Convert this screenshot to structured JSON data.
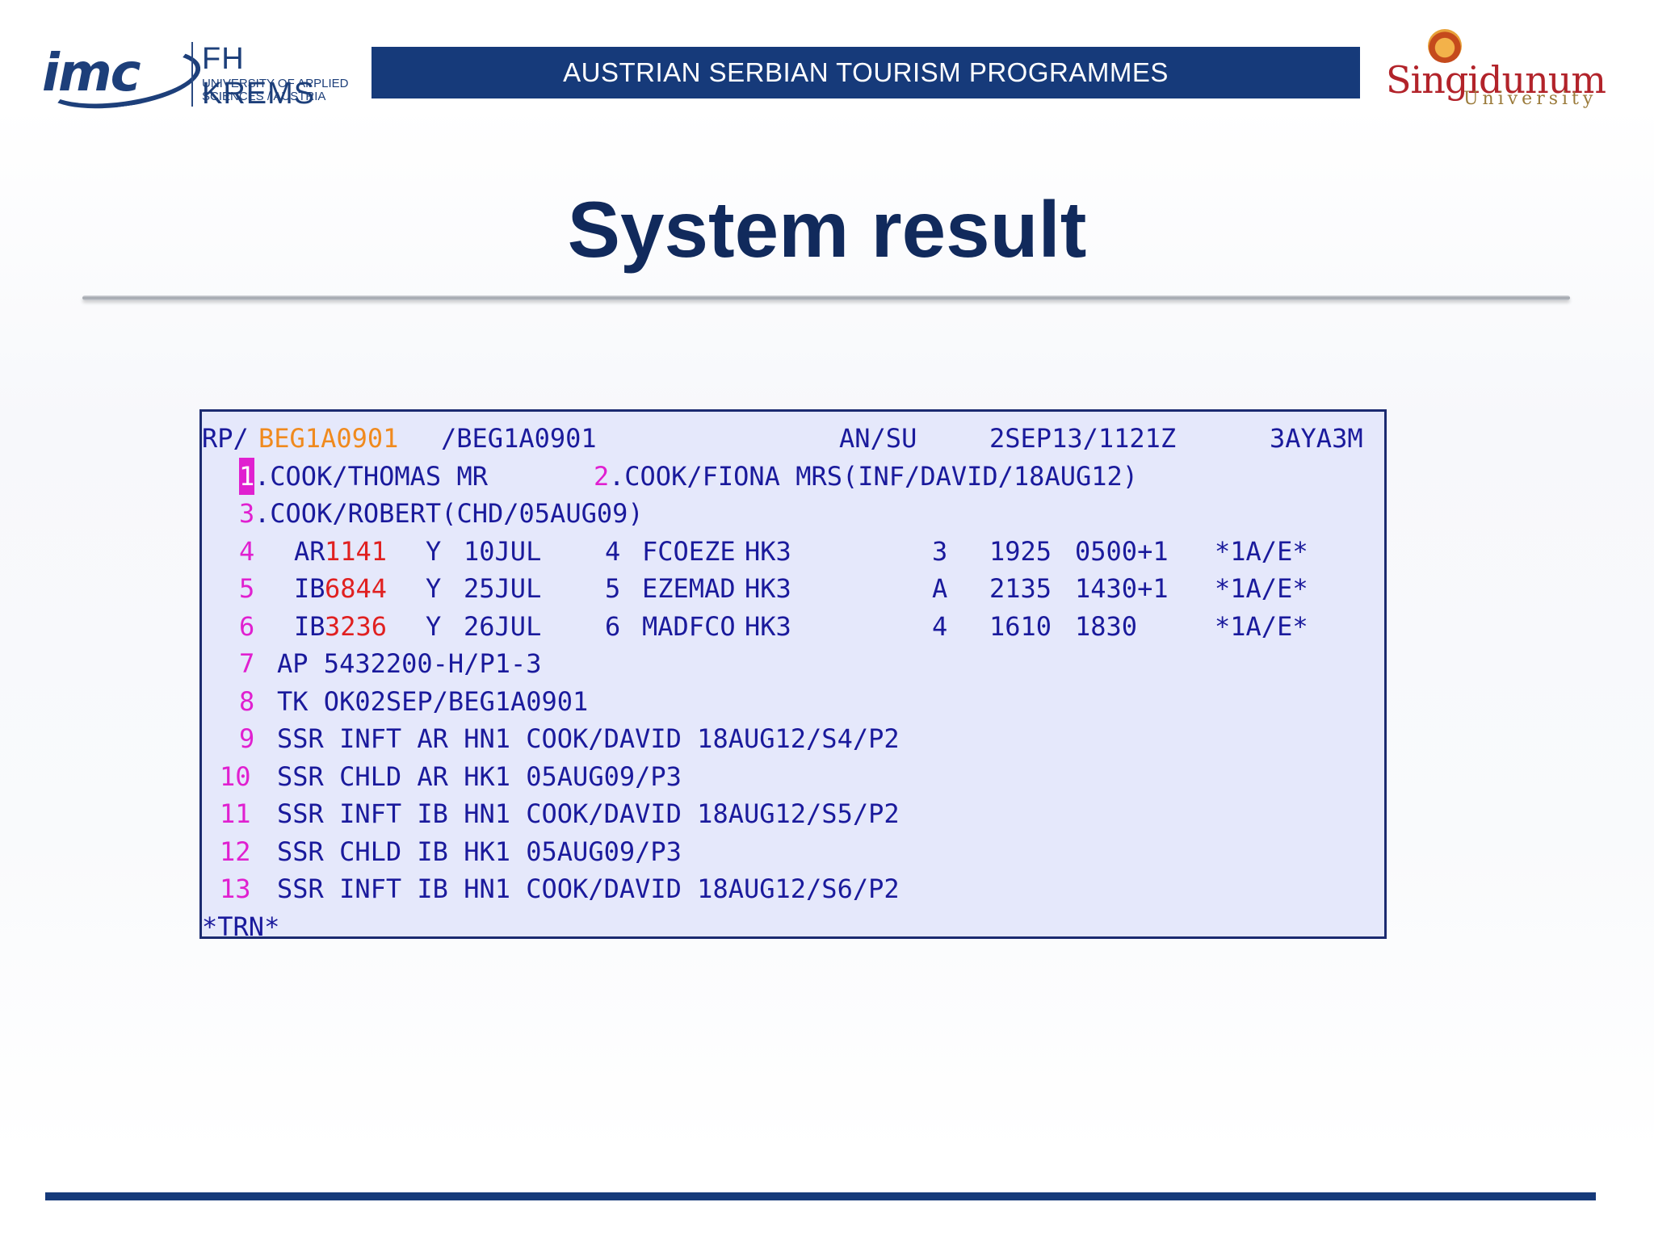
{
  "header": {
    "imc_logo_text": "imc",
    "fh_title": "FH KREMS",
    "fh_subtitle": "UNIVERSITY OF APPLIED SCIENCES / AUSTRIA",
    "banner": "AUSTRIAN SERBIAN TOURISM PROGRAMMES",
    "singi_name": "Singidunum",
    "singi_sub": "University"
  },
  "slide": {
    "title": "System result"
  },
  "terminal": {
    "line1": {
      "prefix": "RP/",
      "office": "BEG1A0901",
      "rest": "/BEG1A0901",
      "agent": "AN/SU",
      "date": "2SEP13/1121Z",
      "record": "3AYA3M"
    },
    "names": [
      {
        "num": "1",
        "text": ".COOK/THOMAS MR"
      },
      {
        "num": "2",
        "text": ".COOK/FIONA MRS(INF/DAVID/18AUG12)"
      },
      {
        "num": "3",
        "text": ".COOK/ROBERT(CHD/05AUG09)"
      }
    ],
    "segments": [
      {
        "num": "4",
        "airline": "AR",
        "flight": "1141",
        "cls": "Y",
        "date": "10JUL",
        "day": "4",
        "route": "FCOEZE",
        "status": "HK3",
        "term": "3",
        "dep": "1925",
        "arr": "0500+1",
        "tag": "*1A/E*"
      },
      {
        "num": "5",
        "airline": "IB",
        "flight": "6844",
        "cls": "Y",
        "date": "25JUL",
        "day": "5",
        "route": "EZEMAD",
        "status": "HK3",
        "term": "A",
        "dep": "2135",
        "arr": "1430+1",
        "tag": "*1A/E*"
      },
      {
        "num": "6",
        "airline": "IB",
        "flight": "3236",
        "cls": "Y",
        "date": "26JUL",
        "day": "6",
        "route": "MADFCO",
        "status": "HK3",
        "term": "4",
        "dep": "1610",
        "arr": "1830",
        "tag": "*1A/E*"
      }
    ],
    "elements": [
      {
        "num": "7",
        "text": "AP 5432200-H/P1-3"
      },
      {
        "num": "8",
        "text": "TK OK02SEP/BEG1A0901"
      },
      {
        "num": "9",
        "text": "SSR INFT AR HN1 COOK/DAVID 18AUG12/S4/P2"
      },
      {
        "num": "10",
        "text": "SSR CHLD AR HK1 05AUG09/P3"
      },
      {
        "num": "11",
        "text": "SSR INFT IB HN1 COOK/DAVID 18AUG12/S5/P2"
      },
      {
        "num": "12",
        "text": "SSR CHLD IB HK1 05AUG09/P3"
      },
      {
        "num": "13",
        "text": "SSR INFT IB HN1 COOK/DAVID 18AUG12/S6/P2"
      }
    ],
    "footer": "*TRN*"
  }
}
